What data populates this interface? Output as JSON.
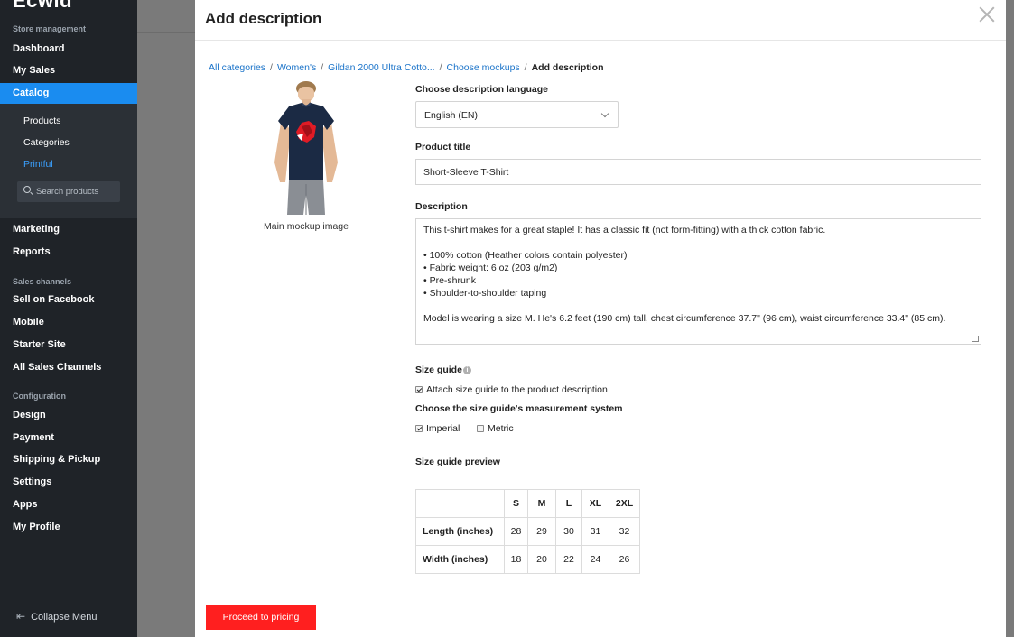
{
  "sidebar": {
    "logo": "Ecwid",
    "section_store": "Store management",
    "dashboard": "Dashboard",
    "my_sales": "My Sales",
    "catalog": "Catalog",
    "products": "Products",
    "categories": "Categories",
    "printful": "Printful",
    "search_placeholder": "Search products",
    "marketing": "Marketing",
    "reports": "Reports",
    "section_channels": "Sales channels",
    "sell_on_facebook": "Sell on Facebook",
    "mobile": "Mobile",
    "starter_site": "Starter Site",
    "all_sales_channels": "All Sales Channels",
    "section_config": "Configuration",
    "design": "Design",
    "payment": "Payment",
    "shipping": "Shipping & Pickup",
    "settings": "Settings",
    "apps": "Apps",
    "my_profile": "My Profile",
    "collapse": "Collapse Menu"
  },
  "modal": {
    "title": "Add description",
    "breadcrumb": {
      "all_categories": "All categories",
      "womens": "Women's",
      "product": "Gildan 2000 Ultra Cotto...",
      "choose_mockups": "Choose mockups",
      "current": "Add description"
    },
    "mockup_caption": "Main mockup image",
    "language_label": "Choose description language",
    "language_value": "English (EN)",
    "title_label": "Product title",
    "title_value": "Short-Sleeve T-Shirt",
    "description_label": "Description",
    "description": {
      "intro": "This t-shirt makes for a great staple! It has a classic fit (not form-fitting) with a thick cotton fabric.",
      "b1": "• 100% cotton (Heather colors contain polyester)",
      "b2": "• Fabric weight: 6 oz (203 g/m2)",
      "b3": "• Pre-shrunk",
      "b4": "• Shoulder-to-shoulder taping",
      "model": "Model is wearing a size M. He's 6.2 feet (190 cm) tall, chest circumference 37.7\" (96 cm), waist circumference 33.4\" (85 cm)."
    },
    "size_guide_label": "Size guide",
    "attach_label": "Attach size guide to the product description",
    "measurement_label": "Choose the size guide's measurement system",
    "imperial": "Imperial",
    "metric": "Metric",
    "preview_label": "Size guide preview",
    "table": {
      "sizes": [
        "S",
        "M",
        "L",
        "XL",
        "2XL"
      ],
      "rows": [
        {
          "label": "Length (inches)",
          "values": [
            "28",
            "29",
            "30",
            "31",
            "32"
          ]
        },
        {
          "label": "Width (inches)",
          "values": [
            "18",
            "20",
            "22",
            "24",
            "26"
          ]
        }
      ]
    },
    "proceed_button": "Proceed to pricing"
  }
}
